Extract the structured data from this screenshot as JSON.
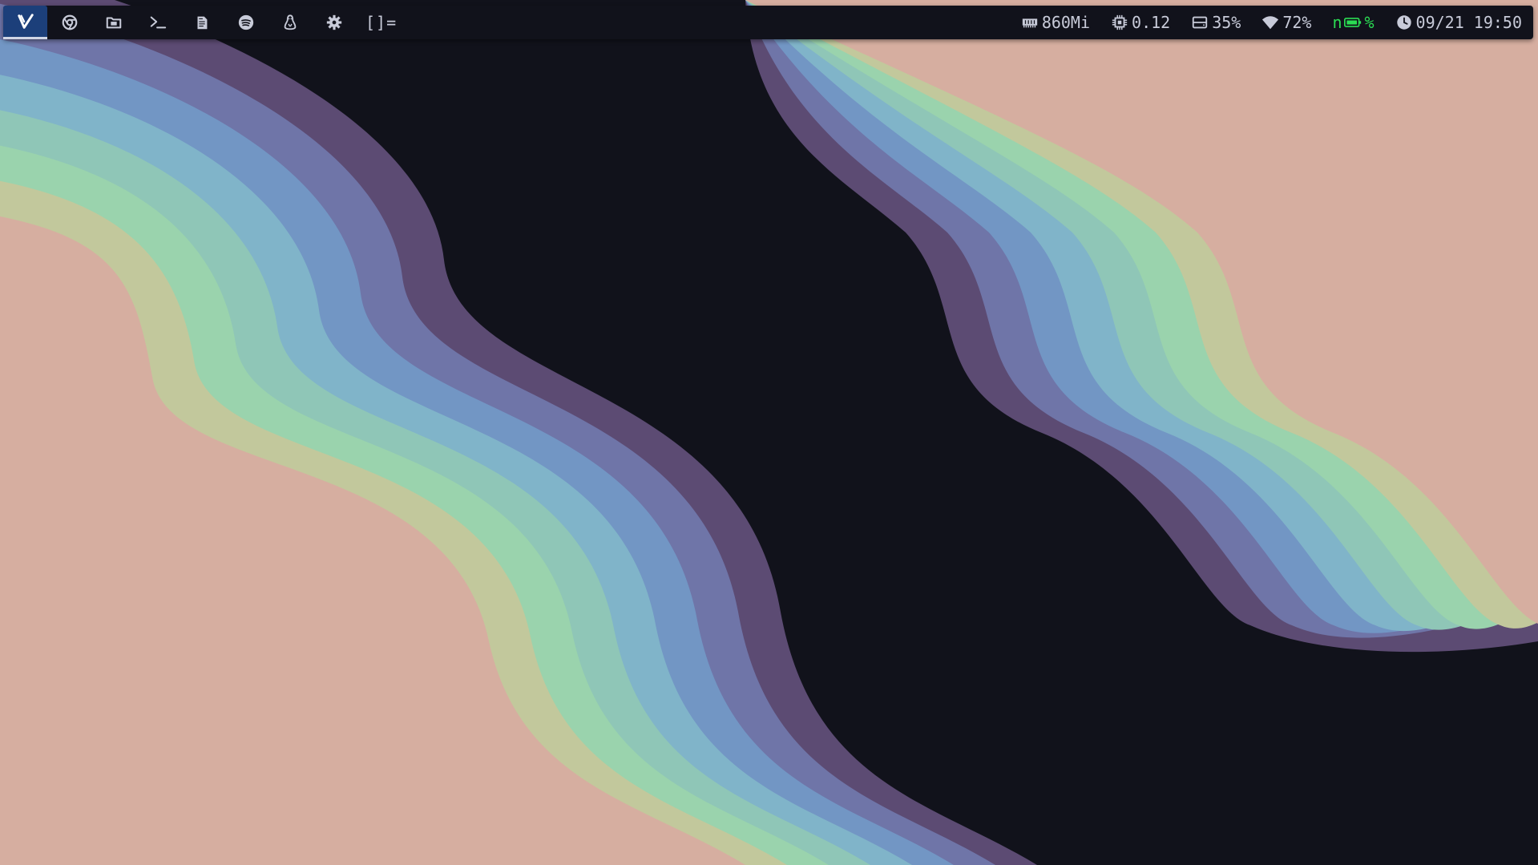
{
  "wallpaper": {
    "background": "#11121b",
    "band_colors": [
      "#d6aea0",
      "#c2c89c",
      "#9ad3ad",
      "#8fc6b7",
      "#80b4c9",
      "#7296c4",
      "#6f75a8",
      "#5c4b73"
    ]
  },
  "bar": {
    "tags": [
      {
        "icon": "vivaldi-icon",
        "active": true
      },
      {
        "icon": "chrome-icon",
        "active": false
      },
      {
        "icon": "file-manager-icon",
        "active": false
      },
      {
        "icon": "terminal-icon",
        "active": false
      },
      {
        "icon": "notes-icon",
        "active": false
      },
      {
        "icon": "spotify-icon",
        "active": false
      },
      {
        "icon": "linux-tux-icon",
        "active": false
      },
      {
        "icon": "gear-icon",
        "active": false
      }
    ],
    "layout_symbol": "[]=",
    "status": {
      "memory": "860Mi",
      "cpu": "0.12",
      "disk": "35%",
      "wifi": "72%",
      "battery_prefix": "n",
      "battery": "%",
      "datetime": "09/21 19:50"
    }
  }
}
